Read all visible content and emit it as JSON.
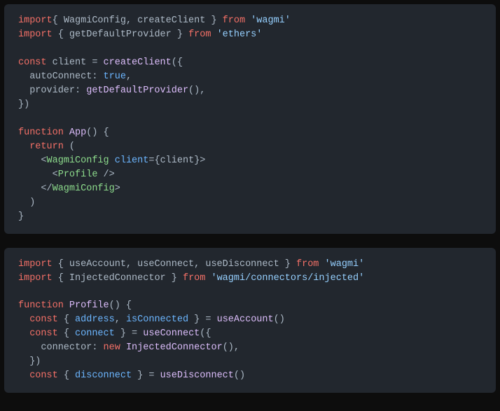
{
  "block1": {
    "l1_import": "import",
    "l1_braceo": "{ ",
    "l1_a": "WagmiConfig",
    "l1_c1": ", ",
    "l1_b": "createClient",
    "l1_bracec": " }",
    "l1_from": " from ",
    "l1_str": "'wagmi'",
    "l2_import": "import",
    "l2_braceo": " { ",
    "l2_a": "getDefaultProvider",
    "l2_bracec": " } ",
    "l2_from": "from ",
    "l2_str": "'ethers'",
    "l3_const": "const",
    "l3_ident": " client ",
    "l3_eq": "= ",
    "l3_fn": "createClient",
    "l3_paren": "({",
    "l4_prop": "  autoConnect: ",
    "l4_val": "true",
    "l4_c": ",",
    "l5_prop": "  provider: ",
    "l5_fn": "getDefaultProvider",
    "l5_paren": "(),",
    "l6": "})",
    "l7_kw": "function",
    "l7_fn": " App",
    "l7_paren": "() {",
    "l8_kw": "  return",
    "l8_paren": " (",
    "l9_o": "    <",
    "l9_tag": "WagmiConfig",
    "l9_sp": " ",
    "l9_attr": "client",
    "l9_eq": "=",
    "l9_bo": "{",
    "l9_val": "client",
    "l9_bc": "}",
    "l9_c": ">",
    "l10_o": "      <",
    "l10_tag": "Profile",
    "l10_c": " />",
    "l11_o": "    </",
    "l11_tag": "WagmiConfig",
    "l11_c": ">",
    "l12": "  )",
    "l13": "}"
  },
  "block2": {
    "l1_import": "import",
    "l1_braceo": " { ",
    "l1_a": "useAccount",
    "l1_c1": ", ",
    "l1_b": "useConnect",
    "l1_c2": ", ",
    "l1_c": "useDisconnect",
    "l1_bracec": " } ",
    "l1_from": "from ",
    "l1_str": "'wagmi'",
    "l2_import": "import",
    "l2_braceo": " { ",
    "l2_a": "InjectedConnector",
    "l2_bracec": " } ",
    "l2_from": "from ",
    "l2_str": "'wagmi/connectors/injected'",
    "l3_kw": "function",
    "l3_fn": " Profile",
    "l3_paren": "() {",
    "l4_kw": "  const",
    "l4_bo": " { ",
    "l4_a": "address",
    "l4_c1": ", ",
    "l4_b": "isConnected",
    "l4_bc": " } = ",
    "l4_fn": "useAccount",
    "l4_paren": "()",
    "l5_kw": "  const",
    "l5_bo": " { ",
    "l5_a": "connect",
    "l5_bc": " } = ",
    "l5_fn": "useConnect",
    "l5_paren": "({",
    "l6_prop": "    connector: ",
    "l6_new": "new",
    "l6_sp": " ",
    "l6_fn": "InjectedConnector",
    "l6_paren": "(),",
    "l7": "  })",
    "l8_kw": "  const",
    "l8_bo": " { ",
    "l8_a": "disconnect",
    "l8_bc": " } = ",
    "l8_fn": "useDisconnect",
    "l8_paren": "()"
  }
}
